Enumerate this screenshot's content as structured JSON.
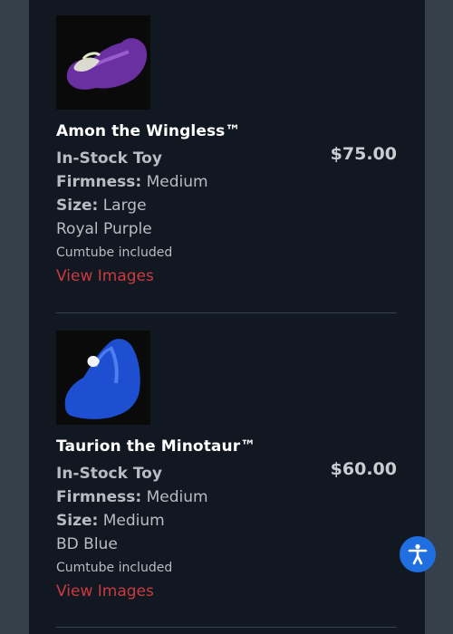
{
  "products": [
    {
      "name": "Amon the Wingless™",
      "price": "$75.00",
      "stock": "In-Stock Toy",
      "firmness_label": "Firmness:",
      "firmness_value": "Medium",
      "size_label": "Size:",
      "size_value": "Large",
      "color": "Royal Purple",
      "extra": "Cumtube included",
      "link": "View Images",
      "thumb_color": "#6a2fa0",
      "thumb_icon": "purple-toy-image"
    },
    {
      "name": "Taurion the Minotaur™",
      "price": "$60.00",
      "stock": "In-Stock Toy",
      "firmness_label": "Firmness:",
      "firmness_value": "Medium",
      "size_label": "Size:",
      "size_value": "Medium",
      "color": "BD Blue",
      "extra": "Cumtube included",
      "link": "View Images",
      "thumb_color": "#1e4fd1",
      "thumb_icon": "blue-toy-image"
    }
  ],
  "accessibility": {
    "icon": "accessibility-icon",
    "color": "#1f6fe0"
  }
}
